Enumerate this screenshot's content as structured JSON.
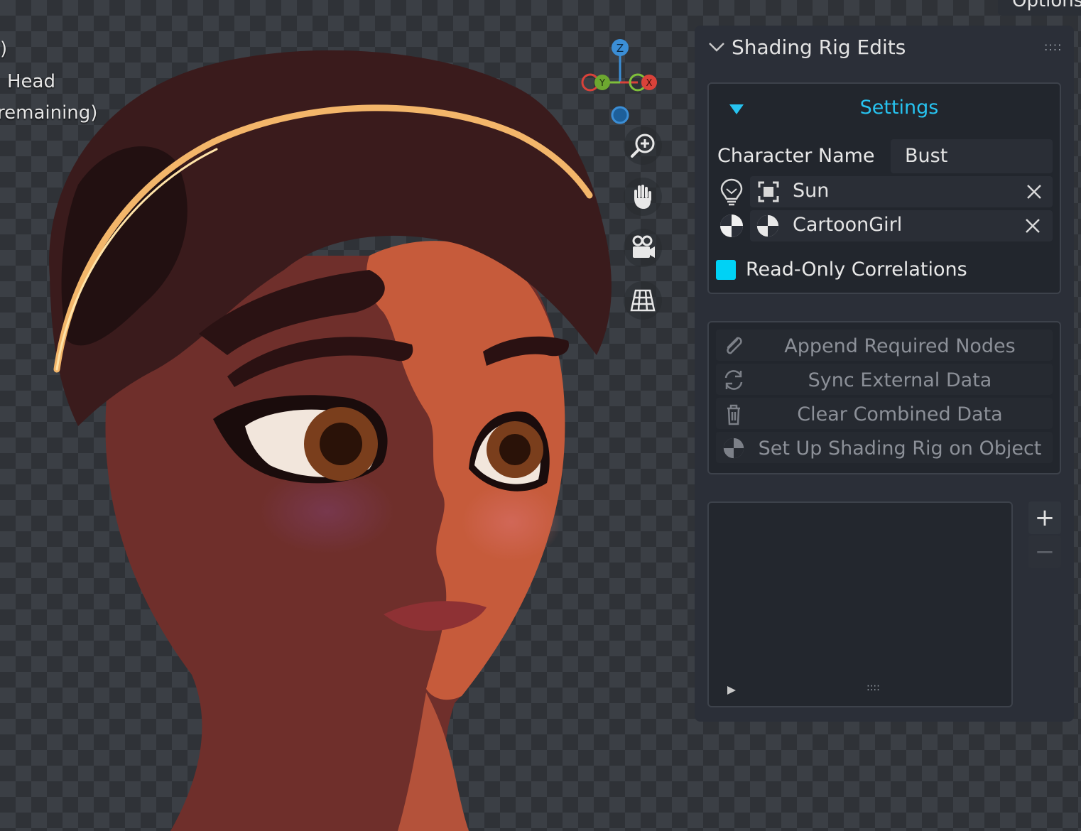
{
  "viewport": {
    "overlay_lines": [
      ")",
      "Head",
      "remaining)"
    ],
    "gizmo_axes": {
      "z": "Z",
      "y": "Y",
      "x": "X"
    },
    "nav_icons": [
      "zoom-icon",
      "hand-pan-icon",
      "camera-icon",
      "grid-ortho-icon"
    ]
  },
  "header": {
    "options_label": "Options"
  },
  "panel": {
    "title": "Shading Rig Edits",
    "settings": {
      "title": "Settings",
      "character_name_label": "Character Name",
      "character_name_value": "Bust",
      "light_object": "Sun",
      "material": "CartoonGirl",
      "read_only_label": "Read-Only Correlations",
      "read_only_checked": true
    },
    "operators": [
      {
        "label": "Append Required Nodes",
        "icon": "paperclip-icon"
      },
      {
        "label": "Sync External Data",
        "icon": "sync-icon"
      },
      {
        "label": "Clear Combined Data",
        "icon": "trash-icon"
      },
      {
        "label": "Set Up Shading Rig on Object",
        "icon": "shading-icon"
      }
    ],
    "list_buttons": {
      "add": "+",
      "remove": "−"
    }
  },
  "colors": {
    "accent": "#27c3f0",
    "checkbox": "#00d2f5",
    "panel_bg": "#2b2f38"
  }
}
